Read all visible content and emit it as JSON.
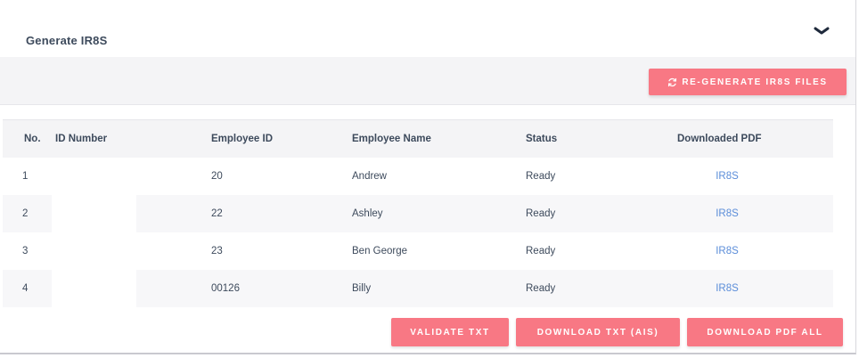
{
  "panel": {
    "title": "Generate IR8S",
    "collapse_icon": "chevron-down-icon"
  },
  "toolbar": {
    "regenerate_label": "RE-GENERATE IR8S FILES",
    "regenerate_icon": "refresh-icon"
  },
  "table": {
    "headers": {
      "no": "No.",
      "id_number": "ID Number",
      "employee_id": "Employee ID",
      "employee_name": "Employee Name",
      "status": "Status",
      "downloaded_pdf": "Downloaded PDF"
    },
    "rows": [
      {
        "no": "1",
        "id_number": "",
        "employee_id": "20",
        "employee_name": "Andrew",
        "status": "Ready",
        "pdf": "IR8S"
      },
      {
        "no": "2",
        "id_number": "",
        "employee_id": "22",
        "employee_name": "Ashley",
        "status": "Ready",
        "pdf": "IR8S"
      },
      {
        "no": "3",
        "id_number": "",
        "employee_id": "23",
        "employee_name": "Ben George",
        "status": "Ready",
        "pdf": "IR8S"
      },
      {
        "no": "4",
        "id_number": "",
        "employee_id": "00126",
        "employee_name": "Billy",
        "status": "Ready",
        "pdf": "IR8S"
      }
    ]
  },
  "footer": {
    "validate_label": "VALIDATE TXT",
    "download_txt_label": "DOWNLOAD TXT (AIS)",
    "download_pdf_label": "DOWNLOAD PDF ALL"
  },
  "colors": {
    "accent": "#f87884",
    "link": "#5b8dd9",
    "text": "#3d4a5c",
    "stripe": "#f4f4f6"
  }
}
